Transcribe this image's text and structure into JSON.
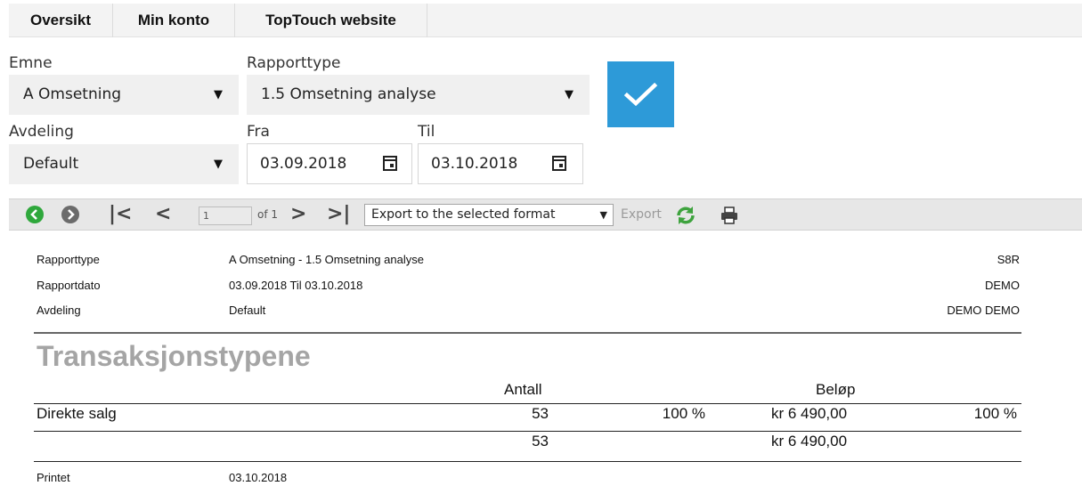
{
  "nav": {
    "tabs": [
      {
        "label": "Oversikt"
      },
      {
        "label": "Min konto"
      },
      {
        "label": "TopTouch website"
      }
    ]
  },
  "filters": {
    "emne": {
      "label": "Emne",
      "value": "A Omsetning"
    },
    "rapporttype": {
      "label": "Rapporttype",
      "value": "1.5 Omsetning analyse"
    },
    "avdeling": {
      "label": "Avdeling",
      "value": "Default"
    },
    "fra": {
      "label": "Fra",
      "value": "03.09.2018"
    },
    "til": {
      "label": "Til",
      "value": "03.10.2018"
    }
  },
  "toolbar": {
    "page": "1",
    "of_pages": "of 1",
    "export_format": "Export to the selected format",
    "export_label": "Export"
  },
  "report": {
    "meta": [
      {
        "label": "Rapporttype",
        "value": "A Omsetning - 1.5 Omsetning analyse",
        "right": "S8R"
      },
      {
        "label": "Rapportdato",
        "value": "03.09.2018 Til 03.10.2018",
        "right": "DEMO"
      },
      {
        "label": "Avdeling",
        "value": "Default",
        "right": "DEMO DEMO"
      }
    ],
    "section_title": "Transaksjonstypene",
    "columns": {
      "antall": "Antall",
      "belop": "Beløp"
    },
    "rows": [
      {
        "name": "Direkte salg",
        "antall": "53",
        "antall_pct": "100 %",
        "belop": "kr 6 490,00",
        "belop_pct": "100 %"
      }
    ],
    "totals": {
      "antall": "53",
      "belop": "kr 6 490,00"
    },
    "footer": {
      "label": "Printet",
      "value": "03.10.2018"
    }
  },
  "colors": {
    "accent": "#2d9ad8",
    "nav_bg": "#f3f3f3",
    "title_gray": "#a5a5a5",
    "green": "#2fa83c"
  }
}
